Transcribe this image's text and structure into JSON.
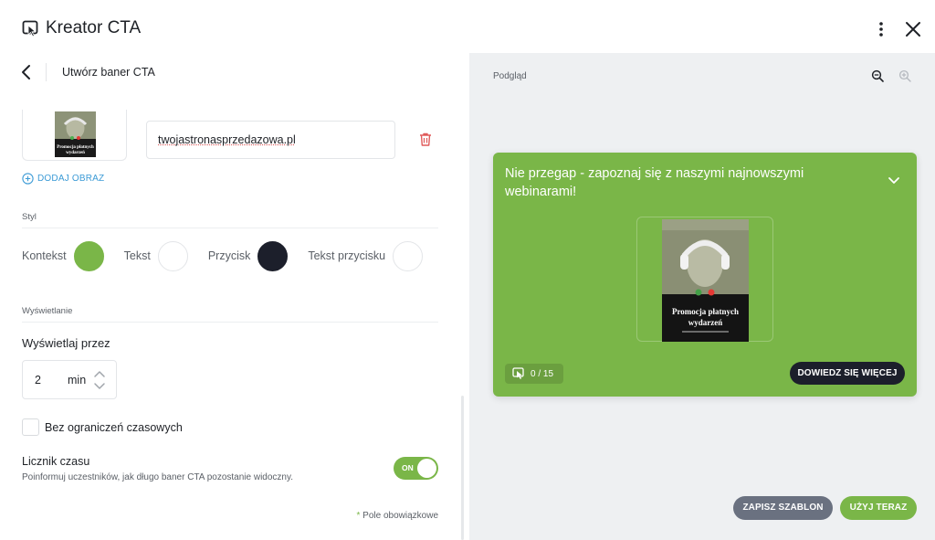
{
  "header": {
    "title": "Kreator CTA",
    "logo_icon": "cta-logo-icon",
    "menu_icon": "kebab-menu-icon",
    "close_icon": "close-icon"
  },
  "editor": {
    "back_icon": "chevron-left-icon",
    "subtitle": "Utwórz baner CTA",
    "image": {
      "url_value": "twojastronasprzedazowa.pl",
      "delete_icon": "trash-icon",
      "add_label": "DODAJ OBRAZ"
    },
    "style": {
      "section_label": "Styl",
      "swatches": [
        {
          "label": "Kontekst",
          "color": "#7ab648"
        },
        {
          "label": "Tekst",
          "color": "#ffffff"
        },
        {
          "label": "Przycisk",
          "color": "#1c1f2b"
        },
        {
          "label": "Tekst przycisku",
          "color": "#ffffff"
        }
      ]
    },
    "display": {
      "section_label": "Wyświetlanie",
      "display_for_label": "Wyświetlaj przez",
      "duration_value": "2",
      "duration_unit": "min",
      "no_limit_label": "Bez ograniczeń czasowych",
      "no_limit_checked": false,
      "timer_title": "Licznik czasu",
      "timer_desc": "Poinformuj uczestników, jak długo baner CTA pozostanie widoczny.",
      "timer_toggle_label": "ON",
      "timer_enabled": true
    },
    "required_note_star": "*",
    "required_note": "Pole obowiązkowe"
  },
  "preview": {
    "label": "Podgląd",
    "zoom_out_icon": "zoom-out-icon",
    "zoom_in_icon": "zoom-in-icon",
    "banner": {
      "headline": "Nie przegap - zapoznaj się z naszymi najnowszymi webinarami!",
      "counter": "0 / 15",
      "cta_label": "DOWIEDZ SIĘ WIĘCEJ",
      "cover_title_line1": "Promocja płatnych",
      "cover_title_line2": "wydarzeń"
    },
    "save_template_label": "ZAPISZ SZABLON",
    "use_now_label": "UŻYJ TERAZ"
  },
  "colors": {
    "accent_green": "#7ab648",
    "dark": "#1c1f2b",
    "link_blue": "#3c9bd6",
    "delete_red": "#e05a5a",
    "secondary_button": "#6a7180"
  }
}
